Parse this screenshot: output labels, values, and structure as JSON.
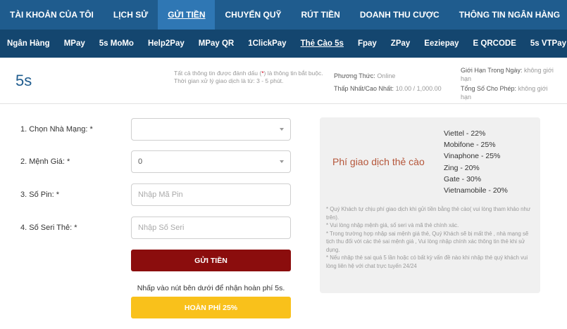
{
  "top_nav": [
    {
      "label": "TÀI KHOẢN CỦA TÔI",
      "active": false
    },
    {
      "label": "LỊCH SỬ",
      "active": false
    },
    {
      "label": "GỬI TIỀN",
      "active": true
    },
    {
      "label": "CHUYỂN QUỸ",
      "active": false
    },
    {
      "label": "RÚT TIỀN",
      "active": false
    },
    {
      "label": "DOANH THU CƯỢC",
      "active": false
    },
    {
      "label": "THÔNG TIN NGÂN HÀNG",
      "active": false
    }
  ],
  "sub_nav": [
    {
      "label": "Ngân Hàng",
      "active": false
    },
    {
      "label": "MPay",
      "active": false
    },
    {
      "label": "5s MoMo",
      "active": false
    },
    {
      "label": "Help2Pay",
      "active": false
    },
    {
      "label": "MPay QR",
      "active": false
    },
    {
      "label": "1ClickPay",
      "active": false
    },
    {
      "label": "Thẻ Cào 5s",
      "active": true
    },
    {
      "label": "Fpay",
      "active": false
    },
    {
      "label": "ZPay",
      "active": false
    },
    {
      "label": "Eeziepay",
      "active": false
    },
    {
      "label": "E QRCODE",
      "active": false
    },
    {
      "label": "5s VTPay",
      "active": false
    }
  ],
  "header": {
    "title": "5s",
    "note_line1_pre": "Tất cả thông tin được đánh dấu (",
    "note_required_mark": "*",
    "note_line1_post": ") là thông tin bắt buộc.",
    "note_line2": "Thời gian xử lý giao dịch là từ: 3 - 5 phút.",
    "method_label": "Phương Thức:",
    "method_value": "Online",
    "minmax_label": "Thấp Nhất/Cao Nhất:",
    "minmax_value": "10.00 / 1,000.00",
    "daily_limit_label": "Giới Hạn Trong Ngày:",
    "daily_limit_value": "không giới hạn",
    "total_allowed_label": "Tổng Số Cho Phép:",
    "total_allowed_value": "không giới hạn"
  },
  "form": {
    "carrier": {
      "label": "1. Chọn Nhà Mạng: *",
      "value": ""
    },
    "denomination": {
      "label": "2. Mệnh Giá: *",
      "value": "0"
    },
    "pin": {
      "label": "3. Số Pin: *",
      "placeholder": "Nhập Mã Pin",
      "value": ""
    },
    "serial": {
      "label": "4. Số Seri Thẻ: *",
      "placeholder": "Nhập Số Seri",
      "value": ""
    },
    "submit_label": "GỬI TIỀN",
    "refund_note": "Nhấp vào nút bên dưới để nhận hoàn phí 5s.",
    "refund_label": "HOÀN PHÍ 25%"
  },
  "fee_panel": {
    "title": "Phí giao dịch thẻ cào",
    "rates": [
      "Viettel - 22%",
      "Mobifone - 25%",
      "Vinaphone - 25%",
      "Zing - 20%",
      "Gate - 30%",
      "Vietnamobile - 20%"
    ],
    "notes": [
      "* Quý Khách tự chịu phí giao dịch khi gửi tiền bằng thẻ cào( vui lòng tham khảo như trên).",
      "* Vui lòng nhập mệnh giá, số seri và mã thẻ chính xác.",
      "* Trong trường hợp nhập sai mệnh giá thẻ, Quý Khách sẽ bị mất thẻ , nhà mạng sẽ tịch thu đối với các thẻ sai mệnh giá , Vui lòng nhập chính xác thông tin thẻ khi sử dụng.",
      "* Nếu nhập thẻ sai quá 5 lần hoặc có bất kỳ vấn đề nào khi nhập thẻ quý khách vui lòng liên hệ với chat trực tuyến 24/24"
    ]
  },
  "colors": {
    "top_nav_bg": "#1f5c8e",
    "top_nav_active": "#2f77b4",
    "sub_nav_bg": "#14466f",
    "title_blue": "#1f5c8e",
    "submit_button": "#8b0d0d",
    "refund_button": "#f9c11b",
    "required_red": "#d0021b"
  }
}
